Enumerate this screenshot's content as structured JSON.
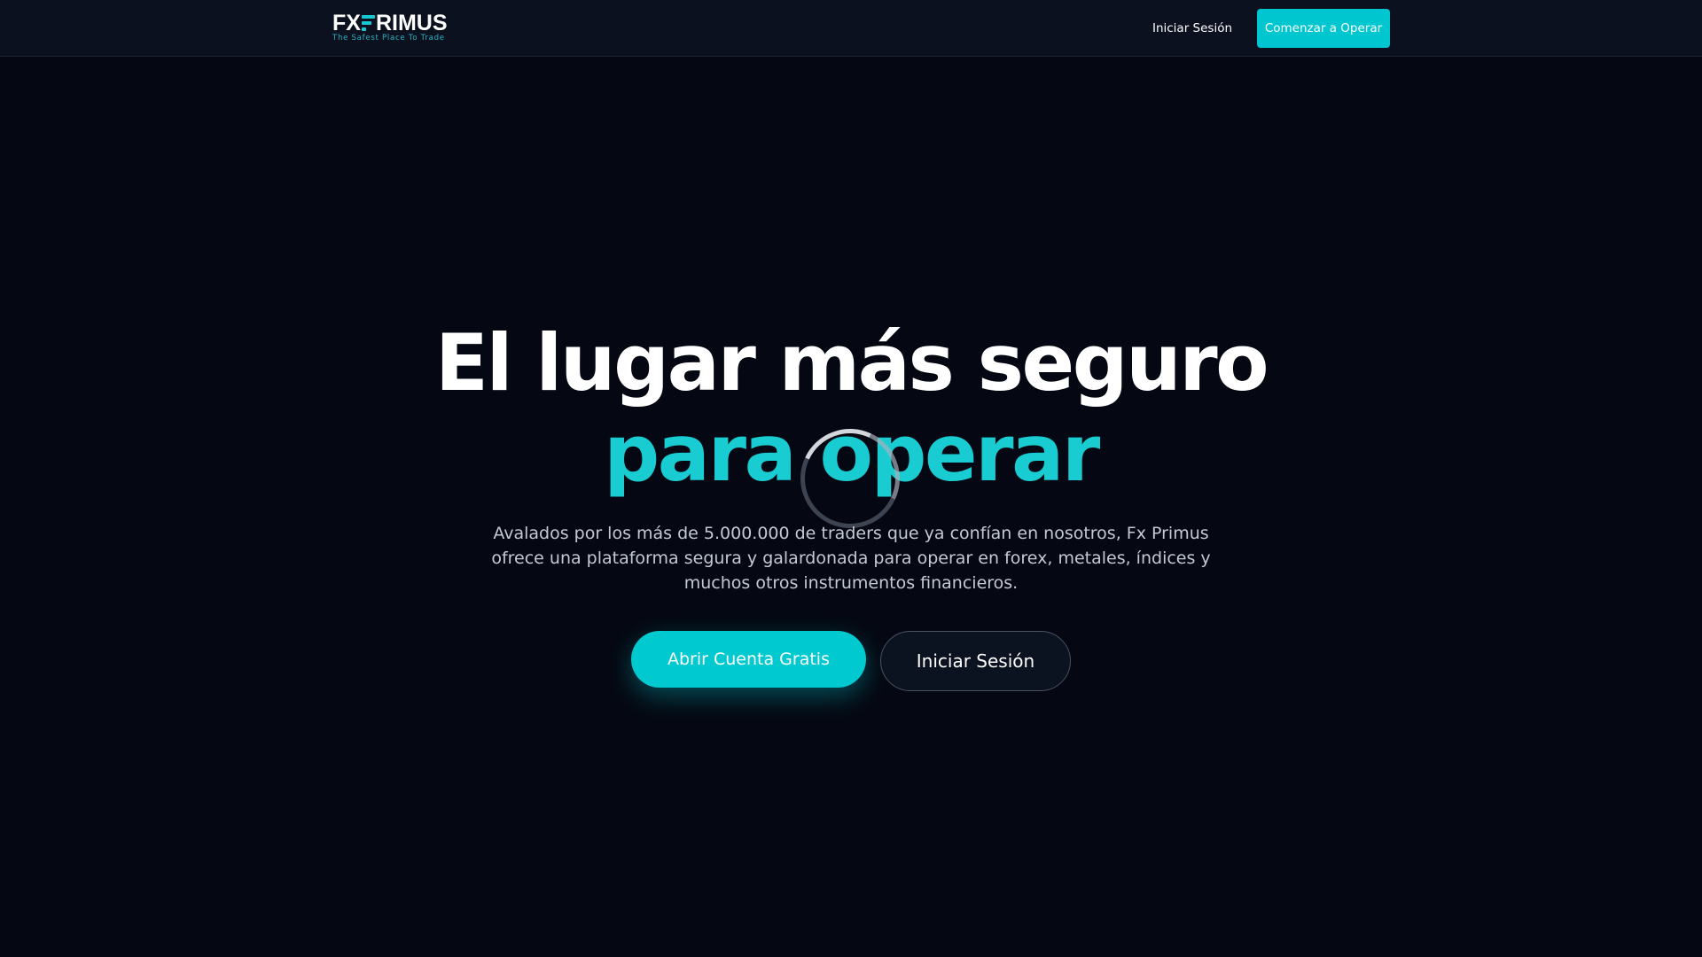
{
  "header": {
    "logo": {
      "text_left": "FX",
      "text_right": "RIMUS",
      "tagline": "The Safest Place To Trade"
    },
    "nav_login_label": "Iniciar Sesión",
    "nav_cta_label": "Comenzar a Operar"
  },
  "hero": {
    "title_line1": "El lugar más seguro",
    "title_line2": "para operar",
    "description": "Avalados por los más de 5.000.000 de traders que ya confían en nosotros, Fx Primus ofrece una plataforma segura y galardonada para operar en forex, metales, índices y muchos otros instrumentos financieros.",
    "primary_button_label": "Abrir Cuenta Gratis",
    "secondary_button_label": "Iniciar Sesión"
  },
  "colors": {
    "background": "#050812",
    "header_background": "#0b111f",
    "accent": "#00c7cf",
    "title_accent": "#18ccd2",
    "body_text": "#c4c9d2"
  },
  "icons": {
    "loading": "loading-spinner-icon",
    "logo_mark": "fxprimus-p-mark-icon"
  }
}
